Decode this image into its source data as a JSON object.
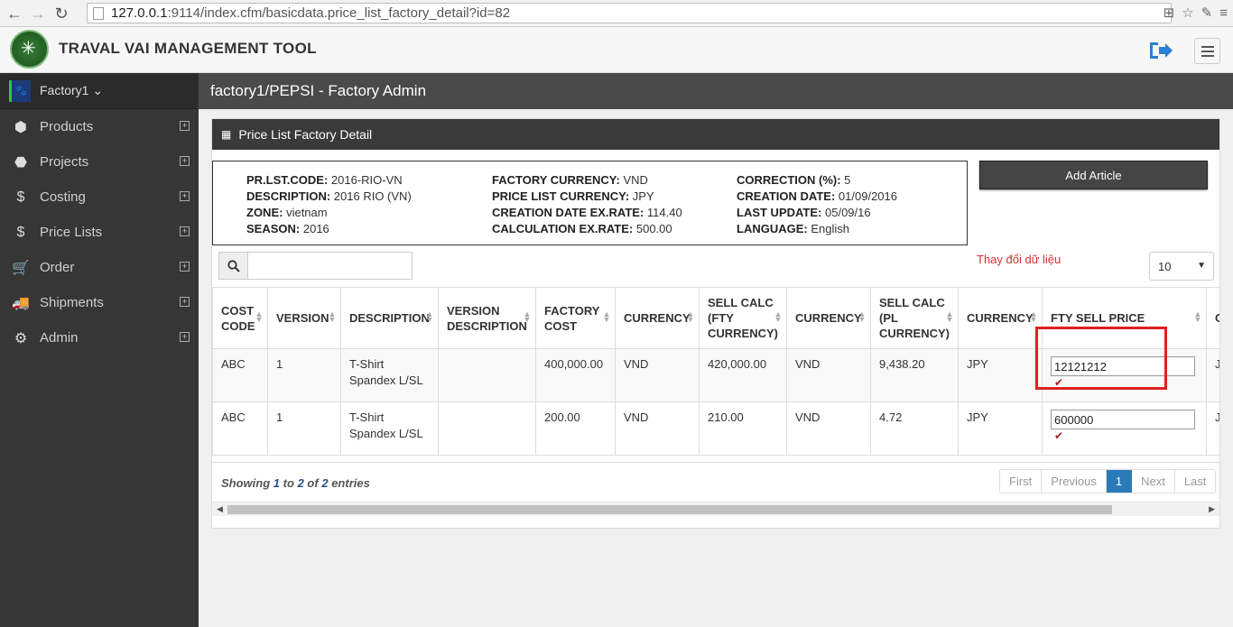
{
  "browser": {
    "url_host": "127.0.0.1",
    "url_rest": ":9114/index.cfm/basicdata.price_list_factory_detail?id=82"
  },
  "app": {
    "title": "TRAVAL VAI MANAGEMENT TOOL"
  },
  "sidebar": {
    "factory_label": "Factory1",
    "items": [
      {
        "label": "Products",
        "icon": "cube-icon"
      },
      {
        "label": "Projects",
        "icon": "cubes-icon"
      },
      {
        "label": "Costing",
        "icon": "dollar-icon"
      },
      {
        "label": "Price Lists",
        "icon": "dollar-icon"
      },
      {
        "label": "Order",
        "icon": "cart-icon"
      },
      {
        "label": "Shipments",
        "icon": "truck-icon"
      },
      {
        "label": "Admin",
        "icon": "gears-icon"
      }
    ]
  },
  "topbar": {
    "title": "factory1/PEPSI - Factory Admin"
  },
  "panel": {
    "title": "Price List Factory Detail"
  },
  "info": {
    "col1": [
      {
        "k": "PR.LST.CODE:",
        "v": "2016-RIO-VN"
      },
      {
        "k": "DESCRIPTION:",
        "v": "2016 RIO (VN)"
      },
      {
        "k": "ZONE:",
        "v": "vietnam"
      },
      {
        "k": "SEASON:",
        "v": "2016"
      }
    ],
    "col2": [
      {
        "k": "FACTORY CURRENCY:",
        "v": "VND"
      },
      {
        "k": "PRICE LIST CURRENCY:",
        "v": "JPY"
      },
      {
        "k": "CREATION DATE EX.RATE:",
        "v": "114.40"
      },
      {
        "k": "CALCULATION EX.RATE:",
        "v": "500.00"
      }
    ],
    "col3": [
      {
        "k": "CORRECTION (%):",
        "v": "5"
      },
      {
        "k": "CREATION DATE:",
        "v": "01/09/2016"
      },
      {
        "k": "LAST UPDATE:",
        "v": "05/09/16"
      },
      {
        "k": "LANGUAGE:",
        "v": "English"
      }
    ]
  },
  "add_article_label": "Add Article",
  "change_note": "Thay đổi dữ liệu",
  "page_size": "10",
  "table": {
    "headers": [
      "COST CODE",
      "VERSION",
      "DESCRIPTION",
      "VERSION DESCRIPTION",
      "FACTORY COST",
      "CURRENCY",
      "SELL CALC (FTY CURRENCY)",
      "CURRENCY",
      "SELL CALC (PL CURRENCY)",
      "CURRENCY",
      "FTY SELL PRICE",
      "C"
    ],
    "rows": [
      {
        "cost_code": "ABC",
        "version": "1",
        "description": "T-Shirt Spandex L/SL",
        "version_description": "",
        "factory_cost": "400,000.00",
        "currency1": "VND",
        "sell_calc_fty": "420,000.00",
        "currency2": "VND",
        "sell_calc_pl": "9,438.20",
        "currency3": "JPY",
        "fty_sell_price": "12121212",
        "extra": "J"
      },
      {
        "cost_code": "ABC",
        "version": "1",
        "description": "T-Shirt Spandex L/SL",
        "version_description": "",
        "factory_cost": "200.00",
        "currency1": "VND",
        "sell_calc_fty": "210.00",
        "currency2": "VND",
        "sell_calc_pl": "4.72",
        "currency3": "JPY",
        "fty_sell_price": "600000",
        "extra": "J"
      }
    ]
  },
  "footer": {
    "showing": "Showing",
    "from": "1",
    "to_word": "to",
    "to": "2",
    "of_word": "of",
    "total": "2",
    "entries": "entries"
  },
  "pager": {
    "first": "First",
    "previous": "Previous",
    "current": "1",
    "next": "Next",
    "last": "Last"
  }
}
